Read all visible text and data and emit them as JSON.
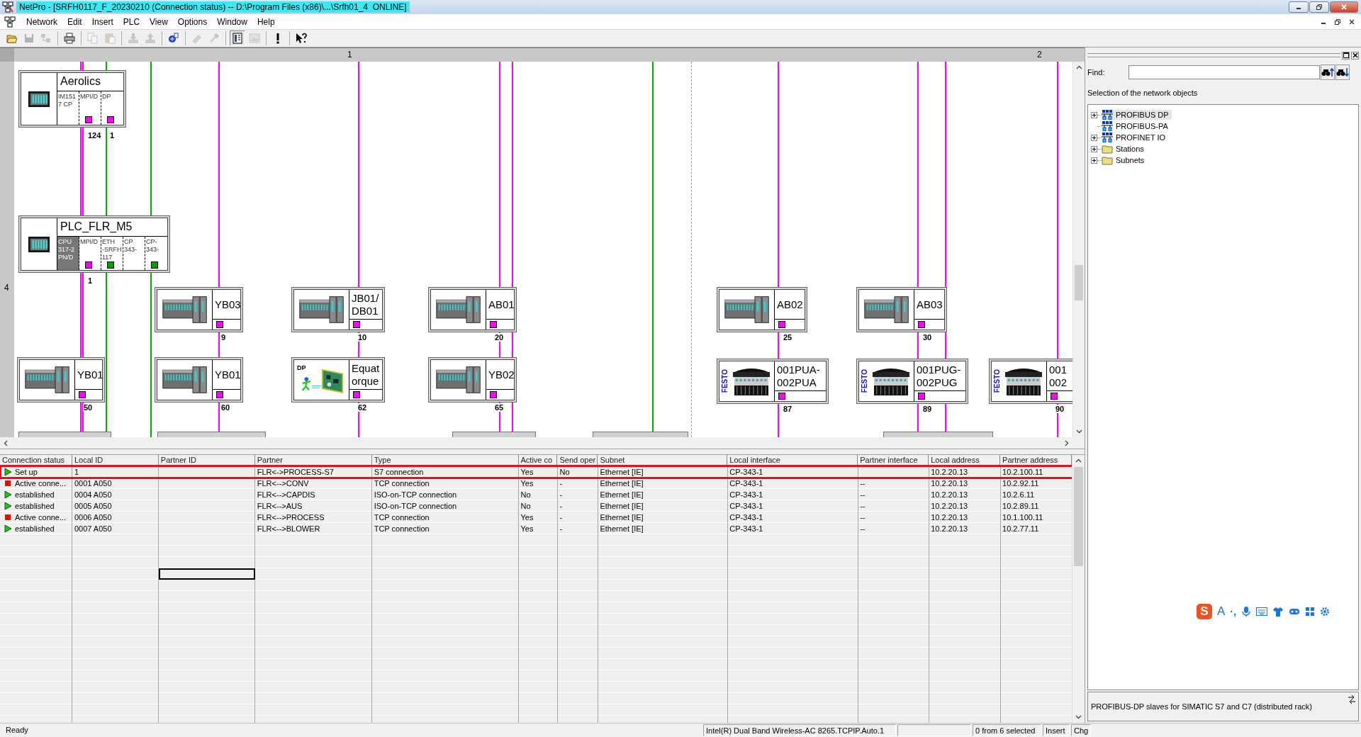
{
  "window": {
    "title": "NetPro - [SRFH0117_F_20230210 (Connection status) -- D:\\Program Files (x86)\\...\\Srfh01_4  ONLINE]"
  },
  "menu": [
    "Network",
    "Edit",
    "Insert",
    "PLC",
    "View",
    "Options",
    "Window",
    "Help"
  ],
  "toolbar": [
    {
      "kind": "open",
      "disabled": false,
      "pressed": false
    },
    {
      "kind": "save",
      "disabled": true,
      "pressed": false
    },
    {
      "kind": "compile",
      "disabled": true,
      "pressed": false
    },
    {
      "kind": "print",
      "disabled": false,
      "pressed": false
    },
    {
      "kind": "copy",
      "disabled": true,
      "pressed": false
    },
    {
      "kind": "paste",
      "disabled": true,
      "pressed": false
    },
    {
      "kind": "download",
      "disabled": true,
      "pressed": false
    },
    {
      "kind": "upload",
      "disabled": true,
      "pressed": false
    },
    {
      "kind": "network",
      "disabled": false,
      "pressed": false
    },
    {
      "kind": "diagnose",
      "disabled": true,
      "pressed": false
    },
    {
      "kind": "configure",
      "disabled": true,
      "pressed": false
    },
    {
      "kind": "catalog",
      "disabled": false,
      "pressed": true
    },
    {
      "kind": "picture",
      "disabled": true,
      "pressed": false
    },
    {
      "kind": "alert",
      "disabled": false,
      "pressed": false
    },
    {
      "kind": "help",
      "disabled": false,
      "pressed": false
    }
  ],
  "canvas": {
    "ruler_columns": [
      "1",
      "2"
    ],
    "ruler_rows": [
      "4"
    ],
    "stations": [
      {
        "kind": "station",
        "name": "Aerolics",
        "slots": [
          {
            "lines": [
              "IM151",
              "7 CP"
            ],
            "selected": false
          },
          {
            "lines": [
              "MPI/D"
            ],
            "selected": false,
            "color": "#ff00ff",
            "address": "124"
          },
          {
            "lines": [
              "DP"
            ],
            "selected": false,
            "color": "#ff00ff",
            "address": "1"
          }
        ]
      },
      {
        "kind": "station",
        "name": "PLC_FLR_M5",
        "slots": [
          {
            "lines": [
              "CPU",
              "317-2",
              "PN/D"
            ],
            "selected": true
          },
          {
            "lines": [
              "MPI/D"
            ],
            "selected": false,
            "color": "#ff00ff",
            "address": "1"
          },
          {
            "lines": [
              "ETH",
              "-SRFH",
              "117"
            ],
            "selected": false,
            "color": "#00a000"
          },
          {
            "lines": [
              "CP",
              "343-"
            ],
            "selected": false
          },
          {
            "lines": [
              "CP-",
              "343-"
            ],
            "selected": false,
            "color": "#00a000"
          }
        ]
      },
      {
        "kind": "rack",
        "name_lines": [
          "YB03"
        ],
        "color": "#ff00ff",
        "address": "9"
      },
      {
        "kind": "rack",
        "name_lines": [
          "JB01/",
          "DB01"
        ],
        "color": "#ff00ff",
        "address": "10"
      },
      {
        "kind": "rack",
        "name_lines": [
          "AB01"
        ],
        "color": "#ff00ff",
        "address": "20"
      },
      {
        "kind": "rack",
        "name_lines": [
          "AB02"
        ],
        "color": "#ff00ff",
        "address": "25"
      },
      {
        "kind": "rack",
        "name_lines": [
          "AB03"
        ],
        "color": "#ff00ff",
        "address": "30"
      },
      {
        "kind": "rack",
        "name_lines": [
          "YB01"
        ],
        "color": "#ff00ff",
        "address": "50"
      },
      {
        "kind": "rack",
        "name_lines": [
          "YB01"
        ],
        "color": "#ff00ff",
        "address": "60"
      },
      {
        "kind": "dp",
        "logo": "DP",
        "name_lines": [
          "Equat",
          "orque"
        ],
        "color": "#ff00ff",
        "address": "62"
      },
      {
        "kind": "rack",
        "name_lines": [
          "YB02"
        ],
        "color": "#ff00ff",
        "address": "65"
      },
      {
        "kind": "festo",
        "logo": "FESTO",
        "name_lines": [
          "001PUA-",
          "002PUA"
        ],
        "color": "#ff00ff",
        "address": "87"
      },
      {
        "kind": "festo",
        "logo": "FESTO",
        "name_lines": [
          "001PUG-",
          "002PUG"
        ],
        "color": "#ff00ff",
        "address": "89"
      },
      {
        "kind": "festo",
        "logo": "FESTO",
        "name_lines": [
          "001",
          "002"
        ],
        "color": "#ff00ff",
        "address": "90"
      }
    ]
  },
  "connections": {
    "columns": [
      "Connection status",
      "Local ID",
      "Partner ID",
      "Partner",
      "Type",
      "Active co",
      "Send oper",
      "Subnet",
      "Local interface",
      "Partner interface",
      "Local address",
      "Partner address"
    ],
    "rows": [
      {
        "kind": "ok",
        "highlighted": true,
        "status_text": "Set up",
        "local_id": "1",
        "partner": "FLR<->PROCESS-S7",
        "type": "S7 connection",
        "active": "Yes",
        "send": "No",
        "subnet": "Ethernet [IE]",
        "local_interface": "CP-343-1",
        "local_address": "10.2.20.13",
        "partner_address": "10.2.100.11"
      },
      {
        "kind": "fault",
        "highlighted": false,
        "status_text": "Active conne...",
        "local_id": "0001 A050",
        "partner": "FLR<-->CONV",
        "type": "TCP connection",
        "active": "Yes",
        "send": "-",
        "subnet": "Ethernet [IE]",
        "local_interface": "CP-343-1",
        "partner_interface": "--",
        "local_address": "10.2.20.13",
        "partner_address": "10.2.92.11"
      },
      {
        "kind": "ok",
        "highlighted": false,
        "status_text": "established",
        "local_id": "0004 A050",
        "partner": "FLR<-->CAPDIS",
        "type": "ISO-on-TCP connection",
        "active": "No",
        "send": "-",
        "subnet": "Ethernet [IE]",
        "local_interface": "CP-343-1",
        "partner_interface": "--",
        "local_address": "10.2.20.13",
        "partner_address": "10.2.6.11"
      },
      {
        "kind": "ok",
        "highlighted": false,
        "status_text": "established",
        "local_id": "0005 A050",
        "partner": "FLR<-->AUS",
        "type": "ISO-on-TCP connection",
        "active": "No",
        "send": "-",
        "subnet": "Ethernet [IE]",
        "local_interface": "CP-343-1",
        "partner_interface": "--",
        "local_address": "10.2.20.13",
        "partner_address": "10.2.89.11"
      },
      {
        "kind": "fault",
        "highlighted": false,
        "status_text": "Active conne...",
        "local_id": "0006 A050",
        "partner": "FLR<-->PROCESS",
        "type": "TCP connection",
        "active": "Yes",
        "send": "-",
        "subnet": "Ethernet [IE]",
        "local_interface": "CP-343-1",
        "partner_interface": "--",
        "local_address": "10.2.20.13",
        "partner_address": "10.1.100.11"
      },
      {
        "kind": "ok",
        "highlighted": false,
        "status_text": "established",
        "local_id": "0007 A050",
        "partner": "FLR<-->BLOWER",
        "type": "TCP connection",
        "active": "Yes",
        "send": "-",
        "subnet": "Ethernet [IE]",
        "local_interface": "CP-343-1",
        "partner_interface": "--",
        "local_address": "10.2.20.13",
        "partner_address": "10.2.77.11"
      }
    ]
  },
  "catalog": {
    "find_label": "Find:",
    "heading": "Selection of the network objects",
    "tree": [
      {
        "label": "PROFIBUS DP",
        "kind": "network",
        "expandable": true,
        "selected": true
      },
      {
        "label": "PROFIBUS-PA",
        "kind": "network",
        "expandable": false,
        "selected": false
      },
      {
        "label": "PROFINET IO",
        "kind": "network",
        "expandable": true,
        "selected": false
      },
      {
        "label": "Stations",
        "kind": "folder",
        "expandable": true,
        "selected": false
      },
      {
        "label": "Subnets",
        "kind": "folder",
        "expandable": true,
        "selected": false
      }
    ],
    "description": "PROFIBUS-DP slaves for SIMATIC S7 and C7 (distributed rack)"
  },
  "ime_toolbar": {
    "logo": "S",
    "mode": "A",
    "punctuation": "·,"
  },
  "status_bar": {
    "message": "Ready",
    "network": "Intel(R) Dual Band Wireless-AC 8265.TCPIP.Auto.1",
    "selection": "0 from 6 selected",
    "mode": "Insert",
    "modified": "Chg"
  }
}
